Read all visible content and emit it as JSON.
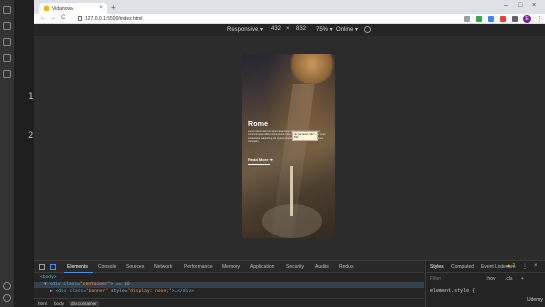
{
  "browser": {
    "tab_title": "Vidanova",
    "url": "127.0.0.1:5500/index.html",
    "new_tab": "+",
    "tab_close": "×",
    "window_controls": [
      "–",
      "□",
      "×"
    ],
    "avatar_letter": "E",
    "menu": "⋮",
    "nav": {
      "back": "←",
      "forward": "→",
      "reload": "C"
    }
  },
  "device_toolbar": {
    "device": "Responsive ▾",
    "width": "432",
    "times": "×",
    "height": "832",
    "zoom": "75% ▾",
    "network": "Online ▾"
  },
  "page": {
    "title": "Rome",
    "body": "Lorem ipsum dolor sit amet consectetur adipisicing elit. Labore amet commodi quae officia minus autem ipsa eum! Lorem ipsum dolor sit amet consectetur adipisicing elit. Quasi voluptatibus officia nemo accusamus numquam.",
    "tooltip": "div.container 432 × 832",
    "read_more": "Read More ➜"
  },
  "devtools": {
    "tabs": [
      "Elements",
      "Console",
      "Sources",
      "Network",
      "Performance",
      "Memory",
      "Application",
      "Security",
      "Audits",
      "Redux"
    ],
    "active_tab": "Elements",
    "warnings": "▲ 2",
    "close": "×",
    "more": "⋮",
    "dom": {
      "line1": "<body>",
      "line2_prefix": "▼ <div class=",
      "line2_class": "\"container\"",
      "line2_suffix": "> == $0",
      "line3_prefix": "▶ <div class=",
      "line3_class": "\"banner\"",
      "line3_style_attr": " style=",
      "line3_style": "\"display: none;\"",
      "line3_suffix": ">…</div>"
    },
    "breadcrumbs": [
      "html",
      "body",
      "div.container"
    ],
    "styles_tabs": [
      "Styles",
      "Computed",
      "Event Listeners"
    ],
    "filter_placeholder": "Filter",
    "filter_tools": [
      ":hov",
      ".cls",
      "+"
    ],
    "rule": "element.style {"
  },
  "ide": {
    "gutter_numbers": [
      "1",
      "2"
    ]
  },
  "watermark": "Udemy",
  "colors": {
    "accent": "#4d8fe6",
    "devtools_bg": "#242424",
    "avatar": "#7b1fa2"
  }
}
